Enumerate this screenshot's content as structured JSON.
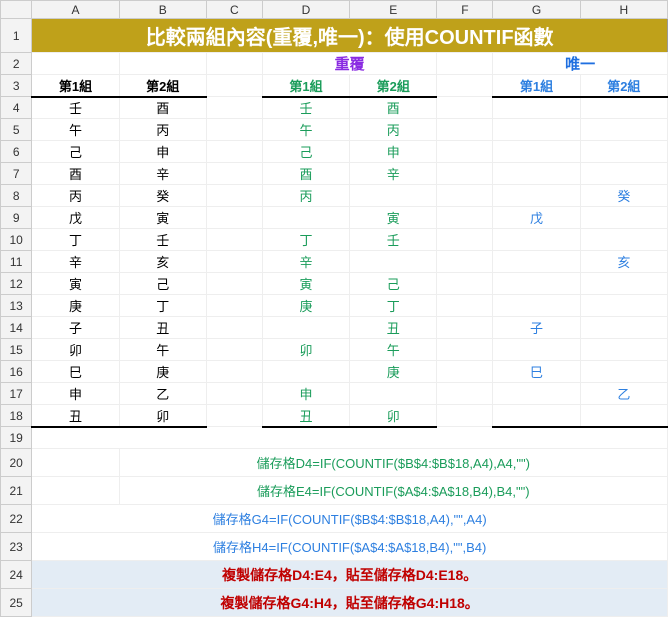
{
  "columns": [
    "A",
    "B",
    "C",
    "D",
    "E",
    "F",
    "G",
    "H"
  ],
  "title": "比較兩組內容(重覆,唯一)：使用COUNTIF函數",
  "sections": {
    "dup": "重覆",
    "unq": "唯一"
  },
  "headers": {
    "g1": "第1組",
    "g2": "第2組"
  },
  "rows": [
    {
      "a": "壬",
      "b": "酉",
      "d": "壬",
      "e": "酉",
      "g": "",
      "h": ""
    },
    {
      "a": "午",
      "b": "丙",
      "d": "午",
      "e": "丙",
      "g": "",
      "h": ""
    },
    {
      "a": "己",
      "b": "申",
      "d": "己",
      "e": "申",
      "g": "",
      "h": ""
    },
    {
      "a": "酉",
      "b": "辛",
      "d": "酉",
      "e": "辛",
      "g": "",
      "h": ""
    },
    {
      "a": "丙",
      "b": "癸",
      "d": "丙",
      "e": "",
      "g": "",
      "h": "癸"
    },
    {
      "a": "戊",
      "b": "寅",
      "d": "",
      "e": "寅",
      "g": "戊",
      "h": ""
    },
    {
      "a": "丁",
      "b": "壬",
      "d": "丁",
      "e": "壬",
      "g": "",
      "h": ""
    },
    {
      "a": "辛",
      "b": "亥",
      "d": "辛",
      "e": "",
      "g": "",
      "h": "亥"
    },
    {
      "a": "寅",
      "b": "己",
      "d": "寅",
      "e": "己",
      "g": "",
      "h": ""
    },
    {
      "a": "庚",
      "b": "丁",
      "d": "庚",
      "e": "丁",
      "g": "",
      "h": ""
    },
    {
      "a": "子",
      "b": "丑",
      "d": "",
      "e": "丑",
      "g": "子",
      "h": ""
    },
    {
      "a": "卯",
      "b": "午",
      "d": "卯",
      "e": "午",
      "g": "",
      "h": ""
    },
    {
      "a": "巳",
      "b": "庚",
      "d": "",
      "e": "庚",
      "g": "巳",
      "h": ""
    },
    {
      "a": "申",
      "b": "乙",
      "d": "申",
      "e": "",
      "g": "",
      "h": "乙"
    },
    {
      "a": "丑",
      "b": "卯",
      "d": "丑",
      "e": "卯",
      "g": "",
      "h": ""
    }
  ],
  "formulas": {
    "d4": "儲存格D4=IF(COUNTIF($B$4:$B$18,A4),A4,\"\")",
    "e4": "儲存格E4=IF(COUNTIF($A$4:$A$18,B4),B4,\"\")",
    "g4": "儲存格G4=IF(COUNTIF($B$4:$B$18,A4),\"\",A4)",
    "h4": "儲存格H4=IF(COUNTIF($A$4:$A$18,B4),\"\",B4)"
  },
  "copy": {
    "line1": "複製儲存格D4:E4，貼至儲存格D4:E18。",
    "line2": "複製儲存格G4:H4，貼至儲存格G4:H18。"
  }
}
